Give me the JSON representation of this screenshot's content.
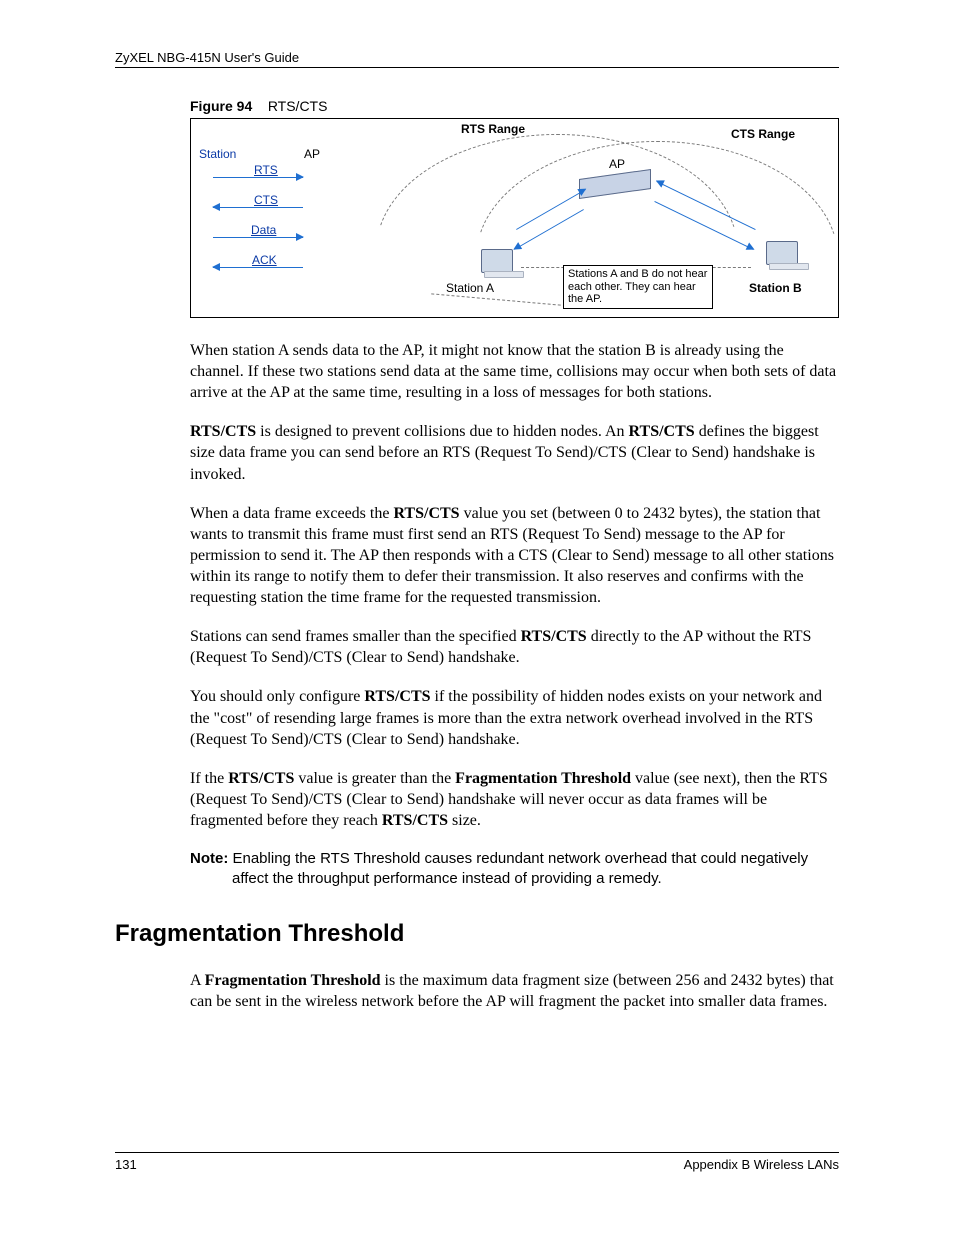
{
  "header": {
    "title": "ZyXEL NBG-415N User's Guide"
  },
  "figure": {
    "label_prefix": "Figure 94",
    "label_title": "RTS/CTS",
    "labels": {
      "rts_range": "RTS Range",
      "cts_range": "CTS Range",
      "station": "Station",
      "ap_left": "AP",
      "ap_center": "AP",
      "rts": "RTS",
      "cts": "CTS",
      "data": "Data",
      "ack": "ACK",
      "station_a": "Station  A",
      "station_b": "Station B",
      "hidden_note": "Stations A and B do not hear each other. They can hear the AP."
    }
  },
  "paras": {
    "p1a": "When station A sends data to the AP, it might not know that the station B is already using the channel. If these two stations send data at the same time, collisions may occur when both sets of data arrive at the AP at the same time, resulting in a loss of messages for both stations.",
    "p2a": "RTS/CTS",
    "p2b": " is designed to prevent collisions due to hidden nodes. An ",
    "p2c": "RTS/CTS",
    "p2d": " defines the biggest size data frame you can send before an RTS (Request To Send)/CTS (Clear to Send) handshake is invoked.",
    "p3a": "When a data frame exceeds the ",
    "p3b": "RTS/CTS",
    "p3c": " value you set (between 0 to 2432 bytes), the station that wants to transmit this frame must first send an RTS (Request To Send) message to the AP for permission to send it. The AP then responds with a CTS (Clear to Send) message to all other stations within its range to notify them to defer their transmission. It also reserves and confirms with the requesting station the time frame for the requested transmission.",
    "p4a": "Stations can send frames smaller than the specified ",
    "p4b": "RTS/CTS",
    "p4c": " directly to the AP without the RTS (Request To Send)/CTS (Clear to Send) handshake.",
    "p5a": "You should only configure ",
    "p5b": "RTS/CTS",
    "p5c": " if the possibility of hidden nodes exists on your network and the \"cost\" of resending large frames is more than the extra network overhead involved in the RTS (Request To Send)/CTS (Clear to Send) handshake.",
    "p6a": "If the ",
    "p6b": "RTS/CTS",
    "p6c": " value is greater than the ",
    "p6d": "Fragmentation Threshold",
    "p6e": " value (see next), then the RTS (Request To Send)/CTS (Clear to Send) handshake will never occur as data frames will be fragmented before they reach ",
    "p6f": "RTS/CTS",
    "p6g": " size.",
    "note_label": "Note:",
    "note_body": " Enabling the RTS Threshold causes redundant network overhead that could negatively affect the throughput performance instead of providing a remedy.",
    "h2": "Fragmentation Threshold",
    "p7a": "A ",
    "p7b": "Fragmentation Threshold",
    "p7c": " is the maximum data fragment size (between 256 and 2432 bytes) that can be sent in the wireless network before the AP will fragment the packet into smaller data frames."
  },
  "footer": {
    "page": "131",
    "section": "Appendix B Wireless LANs"
  }
}
